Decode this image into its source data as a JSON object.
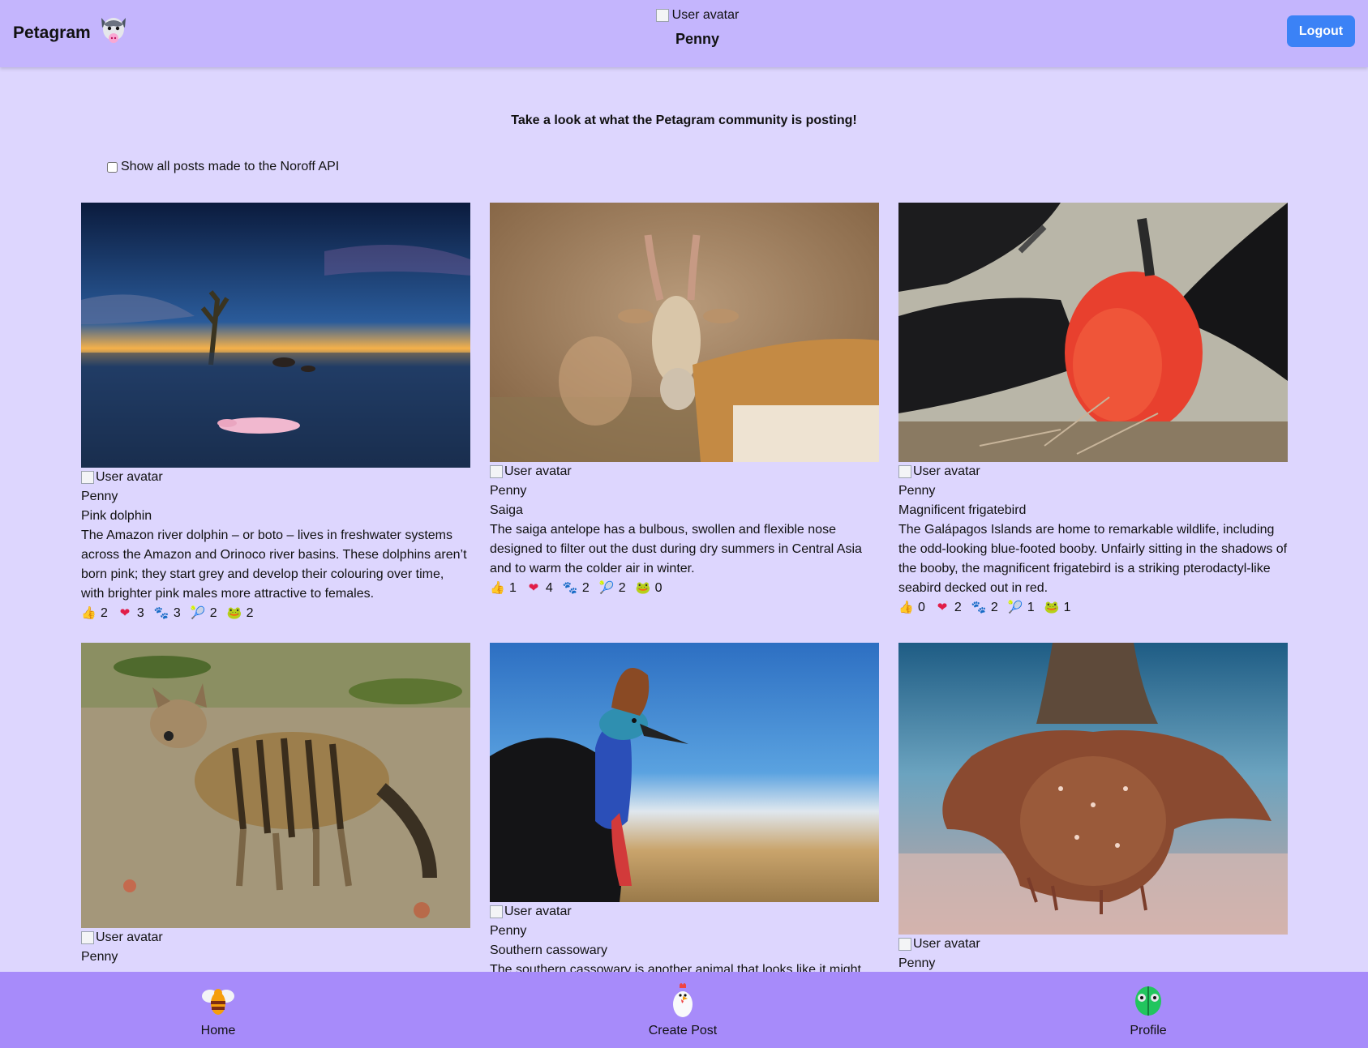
{
  "header": {
    "brand": "Petagram",
    "avatar_alt": "User avatar",
    "user_name": "Penny",
    "logout_label": "Logout"
  },
  "intro": "Take a look at what the Petagram community is posting!",
  "filter_label": "Show all posts made to the Noroff API",
  "posts": [
    {
      "avatar_alt": "User avatar",
      "author": "Penny",
      "title": "Pink dolphin",
      "body": "The Amazon river dolphin – or boto – lives in freshwater systems across the Amazon and Orinoco river basins. These dolphins aren’t born pink; they start grey and develop their colouring over time, with brighter pink males more attractive to females.",
      "reactions": [
        "2",
        "3",
        "3",
        "2",
        "2"
      ]
    },
    {
      "avatar_alt": "User avatar",
      "author": "Penny",
      "title": "Saiga",
      "body": "The saiga antelope has a bulbous, swollen and flexible nose designed to filter out the dust during dry summers in Central Asia and to warm the colder air in winter.",
      "reactions": [
        "1",
        "4",
        "2",
        "2",
        "0"
      ]
    },
    {
      "avatar_alt": "User avatar",
      "author": "Penny",
      "title": "Magnificent frigatebird",
      "body": "The Galápagos Islands are home to remarkable wildlife, including the odd-looking blue-footed booby. Unfairly sitting in the shadows of the booby, the magnificent frigatebird is a striking pterodactyl-like seabird decked out in red.",
      "reactions": [
        "0",
        "2",
        "2",
        "1",
        "1"
      ]
    },
    {
      "avatar_alt": "User avatar",
      "author": "Penny"
    },
    {
      "avatar_alt": "User avatar",
      "author": "Penny",
      "title": "Southern cassowary",
      "body": "The southern cassowary is another animal that looks like it might"
    },
    {
      "avatar_alt": "User avatar",
      "author": "Penny"
    }
  ],
  "reaction_icons": [
    "thumbs-up-icon",
    "heart-icon",
    "paw-icon",
    "ball-icon",
    "frog-icon"
  ],
  "nav": {
    "home": "Home",
    "create": "Create Post",
    "profile": "Profile"
  },
  "colors": {
    "header": "#c4b5fd",
    "page": "#ddd6fe",
    "nav": "#a78bfa",
    "logout": "#3b82f6",
    "heart": "#e11d48"
  }
}
